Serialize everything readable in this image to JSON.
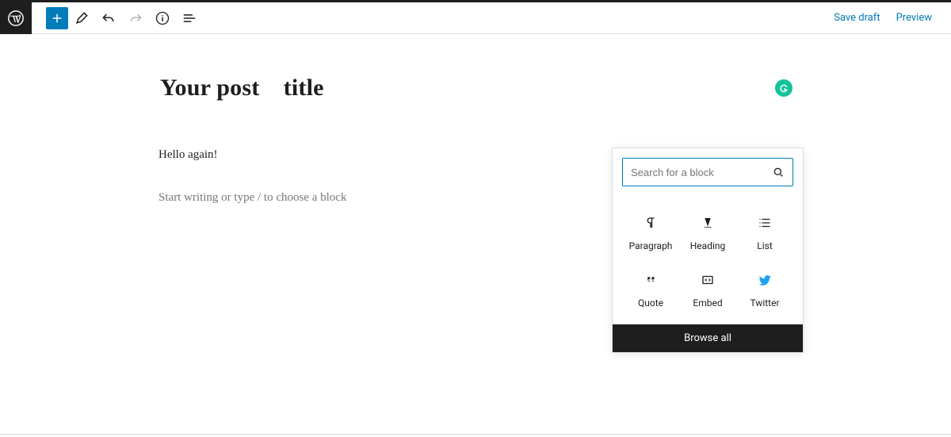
{
  "header": {
    "save_draft": "Save draft",
    "preview": "Preview"
  },
  "editor": {
    "title": "Your post title",
    "body_text": "Hello again!",
    "block_placeholder": "Start writing or type / to choose a block"
  },
  "inserter": {
    "search_placeholder": "Search for a block",
    "items": [
      {
        "label": "Paragraph",
        "icon": "paragraph-icon"
      },
      {
        "label": "Heading",
        "icon": "heading-icon"
      },
      {
        "label": "List",
        "icon": "list-icon"
      },
      {
        "label": "Quote",
        "icon": "quote-icon"
      },
      {
        "label": "Embed",
        "icon": "embed-icon"
      },
      {
        "label": "Twitter",
        "icon": "twitter-icon"
      }
    ],
    "browse_all": "Browse all"
  },
  "colors": {
    "accent": "#007cba",
    "dark": "#1e1e1e",
    "grammarly": "#15c39a",
    "twitter": "#1da1f2"
  }
}
